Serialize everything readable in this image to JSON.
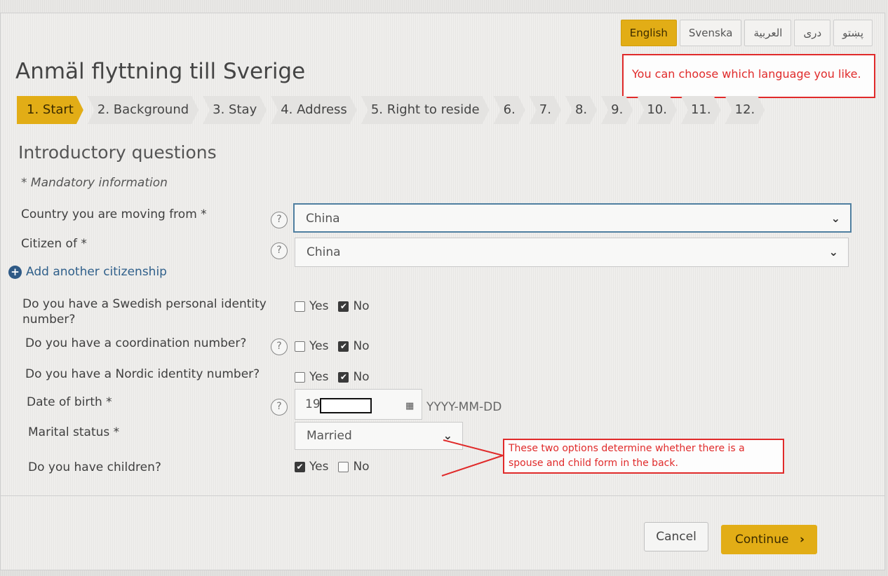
{
  "languages": [
    {
      "label": "English",
      "active": true
    },
    {
      "label": "Svenska"
    },
    {
      "label": "العربية"
    },
    {
      "label": "دری"
    },
    {
      "label": "پښتو"
    }
  ],
  "page_title": "Anmäl flyttning till Sverige",
  "annotations": {
    "language_note": "You can choose which language you like.",
    "options_note": "These two options determine whether there is a spouse and child form in the back."
  },
  "steps": [
    "1. Start",
    "2. Background",
    "3. Stay",
    "4. Address",
    "5. Right to reside",
    "6.",
    "7.",
    "8.",
    "9.",
    "10.",
    "11.",
    "12."
  ],
  "section_title": "Introductory questions",
  "mandatory_note": "* Mandatory information",
  "form": {
    "country_from": {
      "label": "Country you are moving from *",
      "value": "China"
    },
    "citizen_of": {
      "label": "Citizen of *",
      "value": "China"
    },
    "add_citizenship": "Add another citizenship",
    "swedish_id": {
      "label": "Do you have a Swedish personal identity number?",
      "yes": "Yes",
      "no": "No"
    },
    "coordination": {
      "label": "Do you have a coordination number?",
      "yes": "Yes",
      "no": "No"
    },
    "nordic_id": {
      "label": "Do you have a Nordic identity number?",
      "yes": "Yes",
      "no": "No"
    },
    "dob": {
      "label": "Date of birth *",
      "value": "19",
      "format": "YYYY-MM-DD"
    },
    "marital": {
      "label": "Marital status *",
      "value": "Married"
    },
    "children": {
      "label": "Do you have children?",
      "yes": "Yes",
      "no": "No"
    }
  },
  "buttons": {
    "cancel": "Cancel",
    "continue": "Continue"
  },
  "icons": {
    "help": "?",
    "chevron": "⌄",
    "calendar": "▦",
    "plus": "+",
    "check": "✔",
    "arrow": "›"
  }
}
